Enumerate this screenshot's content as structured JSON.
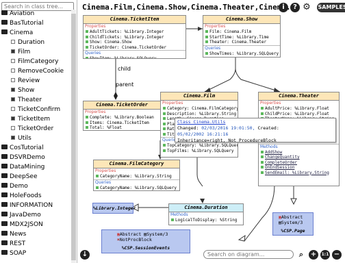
{
  "sidebar": {
    "search_placeholder": "Search in class tree...",
    "items": [
      {
        "label": "Aviation",
        "kind": "package"
      },
      {
        "label": "BasTutorial",
        "kind": "package"
      },
      {
        "label": "Cinema",
        "kind": "package"
      },
      {
        "label": "Duration",
        "kind": "class",
        "checked": false
      },
      {
        "label": "Film",
        "kind": "class",
        "checked": true
      },
      {
        "label": "FilmCategory",
        "kind": "class",
        "checked": false
      },
      {
        "label": "RemoveCookie",
        "kind": "class",
        "checked": false
      },
      {
        "label": "Review",
        "kind": "class",
        "checked": false
      },
      {
        "label": "Show",
        "kind": "class",
        "checked": true
      },
      {
        "label": "Theater",
        "kind": "class",
        "checked": true
      },
      {
        "label": "TicketConfirm",
        "kind": "class",
        "checked": false
      },
      {
        "label": "TicketItem",
        "kind": "class",
        "checked": true
      },
      {
        "label": "TicketOrder",
        "kind": "class",
        "checked": false
      },
      {
        "label": "Utils",
        "kind": "class",
        "checked": true
      },
      {
        "label": "CosTutorial",
        "kind": "package"
      },
      {
        "label": "DSVRDemo",
        "kind": "package"
      },
      {
        "label": "DataMining",
        "kind": "package"
      },
      {
        "label": "DeepSee",
        "kind": "package"
      },
      {
        "label": "Demo",
        "kind": "package"
      },
      {
        "label": "HoleFoods",
        "kind": "package"
      },
      {
        "label": "INFORMATION",
        "kind": "package"
      },
      {
        "label": "JavaDemo",
        "kind": "package"
      },
      {
        "label": "MDX2JSON",
        "kind": "package"
      },
      {
        "label": "News",
        "kind": "package"
      },
      {
        "label": "REST",
        "kind": "package"
      },
      {
        "label": "SOAP",
        "kind": "package"
      }
    ]
  },
  "toolbar": {
    "title": "Cinema.Film,Cinema.Show,Cinema.Theater,Cinema...",
    "info_icon": "i",
    "help_icon": "?",
    "settings_icon": "gear-icon",
    "samples_label": "SAMPLES",
    "bottom_search_placeholder": "Search on diagram...",
    "zoom_reset_label": "1:1"
  },
  "boxes": {
    "ticketitem": {
      "title": "Cinema.TicketItem",
      "props_label": "Properties",
      "props": [
        "AdultTickets: %Library.Integer",
        "ChildTickets: %Library.Integer",
        "Show: Cinema.Show",
        "TicketOrder: Cinema.TicketOrder"
      ],
      "queries_label": "Queries",
      "queries": [
        "ShowItem: %Library.SQLQuery"
      ]
    },
    "show": {
      "title": "Cinema.Show",
      "props_label": "Properties",
      "props": [
        "Film: Cinema.Film",
        "StartTime: %Library.Time",
        "Theater: Cinema.Theater"
      ],
      "queries_label": "Queries",
      "queries": [
        "ShowTimes: %Library.SQLQuery"
      ]
    },
    "ticketorder": {
      "title": "Cinema.TicketOrder",
      "props_label": "Properties",
      "props": [
        "Complete: %Library.Boolean",
        "Items: Cinema.TicketItem",
        "Total: %Float"
      ]
    },
    "film": {
      "title": "Cinema.Film",
      "props_label": "Properties",
      "props": [
        "Category: Cinema.FilmCategory",
        "Description: %Library.String",
        "Length: Cinema.Duration",
        "PlayingNow: %Library.Boolean",
        "Rat",
        "Tit"
      ],
      "queries_label": "Queries",
      "queries": [
        "TopCategory: %Library.SQLQuery",
        "TopFilms: %Library.SQLQuery"
      ]
    },
    "theater": {
      "title": "Cinema.Theater",
      "props_label": "Properties",
      "props": [
        "AdultPrice: %Library.Float",
        "ChildPrice: %Library.Float",
        "TheaterName: %Library.String"
      ],
      "methods_label": "Methods",
      "methods": [
        "AddShow",
        "ChangeQuantity",
        "CompleteOrder",
        "OnEndSession",
        "SendEmail: %Library.String"
      ]
    },
    "filmcategory": {
      "title": "Cinema.FilmCategory",
      "props_label": "Properties",
      "props": [
        "CategoryName: %Library.String"
      ],
      "queries_label": "Queries",
      "queries": [
        "CategoryName: %Library.SQLQuery"
      ]
    },
    "duration": {
      "title": "Cinema.Duration",
      "methods_label": "Methods",
      "methods": [
        "LogicalToDisplay: %String"
      ]
    },
    "libinteger": {
      "title": "%Library.Integer"
    },
    "cspsession": {
      "abstract": "Abstract",
      "system": "System/3",
      "notproc": "NotProcBlock",
      "title": "%CSP.SessionEvents"
    },
    "csppage": {
      "abstract": "Abstract",
      "system": "System/3",
      "title": "%CSP.Page"
    }
  },
  "tooltip": {
    "link": "Class Cinema.Utils",
    "changed_label": "Changed:",
    "changed_value": "02/03/2016 19:01:50,",
    "created_label": "Created:",
    "created_value": "05/02/2002 16:21:16",
    "line3": "Inheritance=right, Not ProcedureBlock"
  },
  "edge_labels": {
    "child": "child",
    "parent": "parent"
  }
}
